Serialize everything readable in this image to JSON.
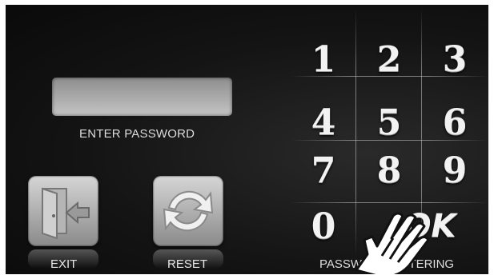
{
  "password": {
    "label": "ENTER PASSWORD",
    "value": ""
  },
  "buttons": {
    "exit_label": "EXIT",
    "reset_label": "RESET"
  },
  "keypad": {
    "keys": [
      "1",
      "2",
      "3",
      "4",
      "5",
      "6",
      "7",
      "8",
      "9",
      "0",
      "OK"
    ]
  },
  "status_text": "PASSWORD ENTERING",
  "colors": {
    "background": "#141414",
    "field": "#b0b0b0",
    "text": "#dddddd"
  },
  "icons": [
    "exit-door-icon",
    "reset-arrows-icon",
    "hand-pointer-icon"
  ]
}
